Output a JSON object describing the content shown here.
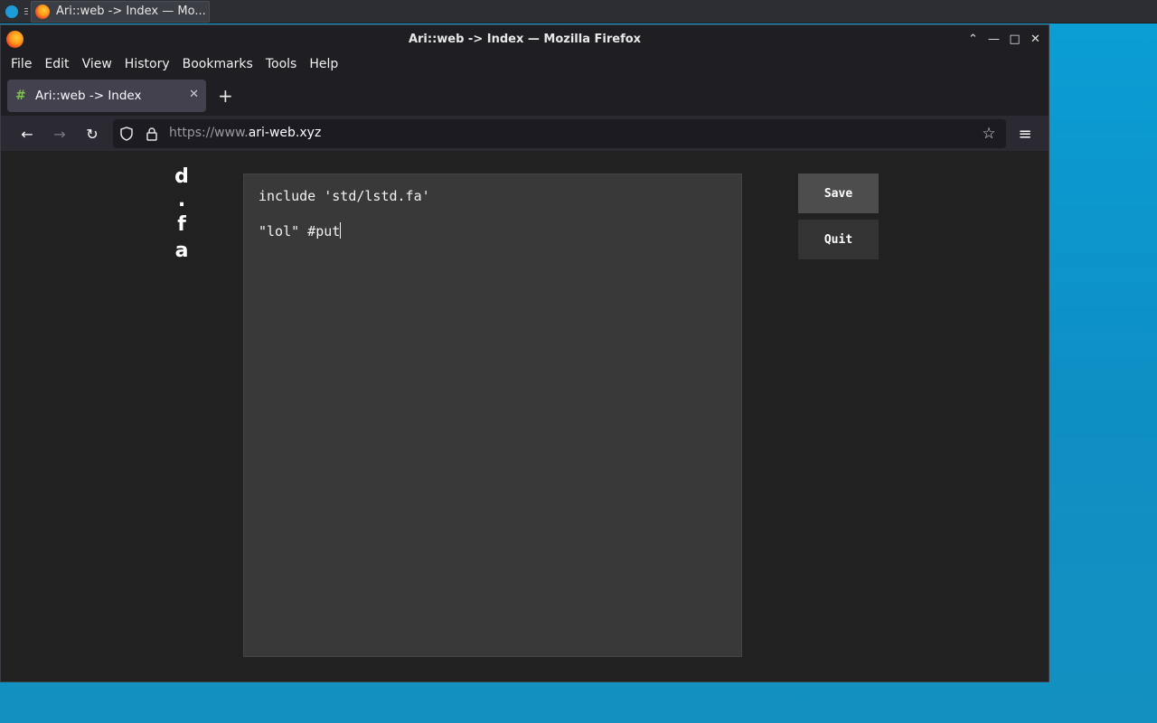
{
  "taskbar": {
    "task_title": "Ari::web -> Index — Mo..."
  },
  "window": {
    "title": "Ari::web -> Index — Mozilla Firefox",
    "controls": {
      "collapse": "⌃",
      "minimize": "—",
      "maximize": "□",
      "close": "✕"
    }
  },
  "menubar": {
    "items": [
      "File",
      "Edit",
      "View",
      "History",
      "Bookmarks",
      "Tools",
      "Help"
    ]
  },
  "tab": {
    "label": "Ari::web -> Index",
    "favicon": "#",
    "close": "✕",
    "new_tab": "+"
  },
  "navbar": {
    "back": "←",
    "forward": "→",
    "reload": "↻",
    "url_prefix": "https://www.",
    "url_domain": "ari-web.xyz",
    "bookmark_star": "☆",
    "menu": "≡"
  },
  "page": {
    "logo": [
      "d",
      ".",
      "f",
      "a"
    ],
    "editor_lines": [
      "include 'std/lstd.fa'",
      "\"lol\" #put"
    ],
    "save_label": "Save",
    "quit_label": "Quit"
  },
  "colors": {
    "desktop": "#0a9fd6",
    "page_bg": "#212121",
    "editor_bg": "#393939",
    "save_bg": "#4d4d4d",
    "quit_bg": "#333333"
  }
}
